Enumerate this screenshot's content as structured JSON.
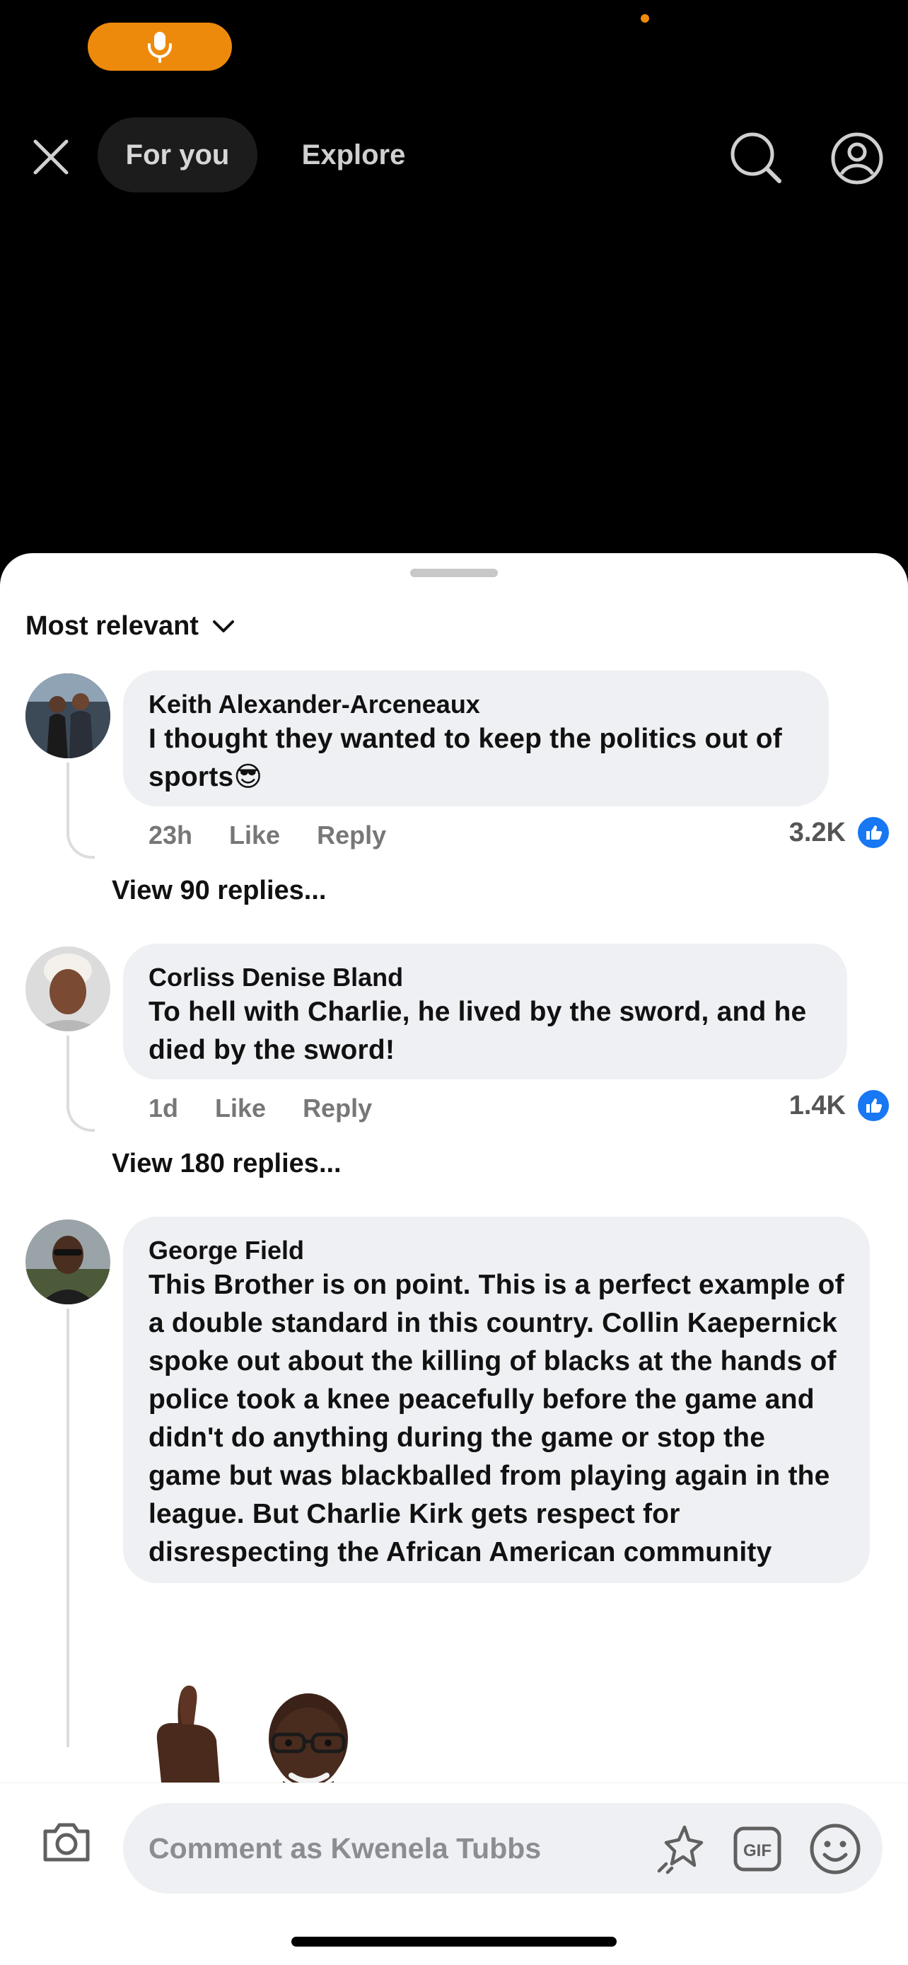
{
  "status": {
    "mic_label": "microphone active"
  },
  "nav": {
    "tabs": [
      {
        "label": "For you"
      },
      {
        "label": "Explore"
      }
    ]
  },
  "sheet": {
    "sort_label": "Most relevant"
  },
  "comments": [
    {
      "author": "Keith Alexander-Arceneaux",
      "text": "I thought they wanted to keep the politics out of sports",
      "emoji": "😎",
      "age": "23h",
      "like": "Like",
      "reply": "Reply",
      "reactions": "3.2K",
      "view_replies": "View 90 replies..."
    },
    {
      "author": "Corliss Denise Bland",
      "text": "To hell with Charlie, he lived by the sword, and he died by the sword!",
      "age": "1d",
      "like": "Like",
      "reply": "Reply",
      "reactions": "1.4K",
      "view_replies": "View 180 replies..."
    },
    {
      "author": "George Field",
      "text": "This Brother is on point.  This is a perfect example of a double standard in this country.  Collin Kaepernick  spoke out about the killing of blacks at the hands of police took a knee peacefully before the game and didn't do anything during the game or stop the game but was blackballed from playing again in the league.  But Charlie Kirk gets respect for disrespecting the African American community"
    }
  ],
  "composer": {
    "placeholder": "Comment as Kwenela Tubbs"
  },
  "colors": {
    "accent": "#ee8a0b",
    "like_blue": "#1877f2"
  }
}
